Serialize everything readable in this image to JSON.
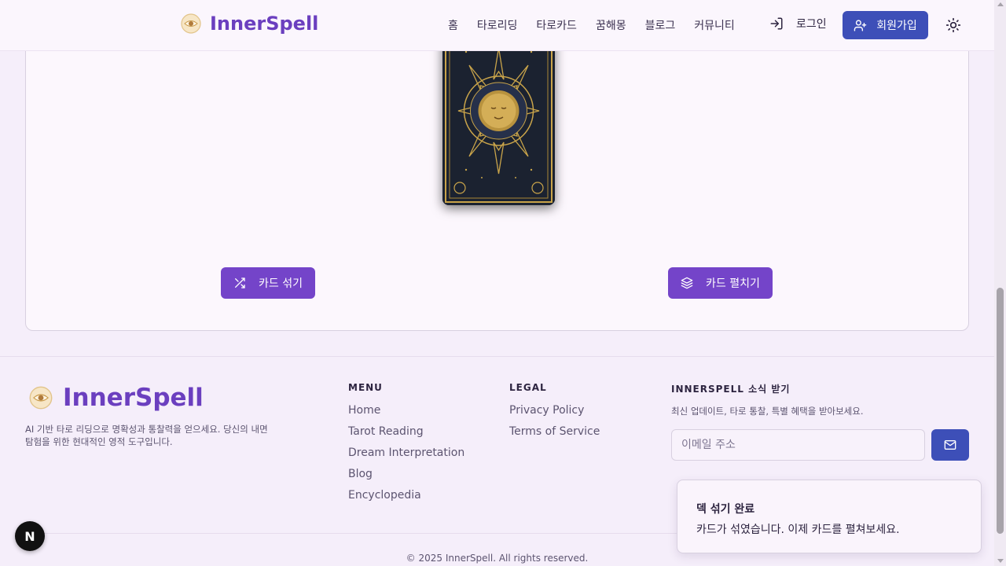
{
  "header": {
    "brand": "InnerSpell",
    "nav": [
      "홈",
      "타로리딩",
      "타로카드",
      "꿈해몽",
      "블로그",
      "커뮤니티"
    ],
    "login_label": "로그인",
    "signup_label": "회원가입"
  },
  "reading": {
    "shuffle_label": "카드 섞기",
    "spread_label": "카드 펼치기"
  },
  "footer": {
    "brand": "InnerSpell",
    "description": "AI 기반 타로 리딩으로 명확성과 통찰력을 얻으세요. 당신의 내면 탐험을 위한 현대적인 영적 도구입니다.",
    "menu_title": "MENU",
    "menu": [
      "Home",
      "Tarot Reading",
      "Dream Interpretation",
      "Blog",
      "Encyclopedia"
    ],
    "legal_title": "LEGAL",
    "legal": [
      "Privacy Policy",
      "Terms of Service"
    ],
    "news_title": "INNERSPELL 소식 받기",
    "news_subtitle": "최신 업데이트, 타로 통찰, 특별 혜택을 받아보세요.",
    "email_placeholder": "이메일 주소",
    "copyright": "© 2025 InnerSpell. All rights reserved."
  },
  "toast": {
    "title": "덱 섞기 완료",
    "message": "카드가 섞였습니다. 이제 카드를 펼쳐보세요."
  },
  "dev_badge": "N",
  "colors": {
    "brand_purple": "#6b3fbf",
    "button_purple": "#7444c9",
    "button_blue": "#3d4fb8",
    "card_gold": "#c9a44a",
    "card_navy": "#1b2230"
  }
}
